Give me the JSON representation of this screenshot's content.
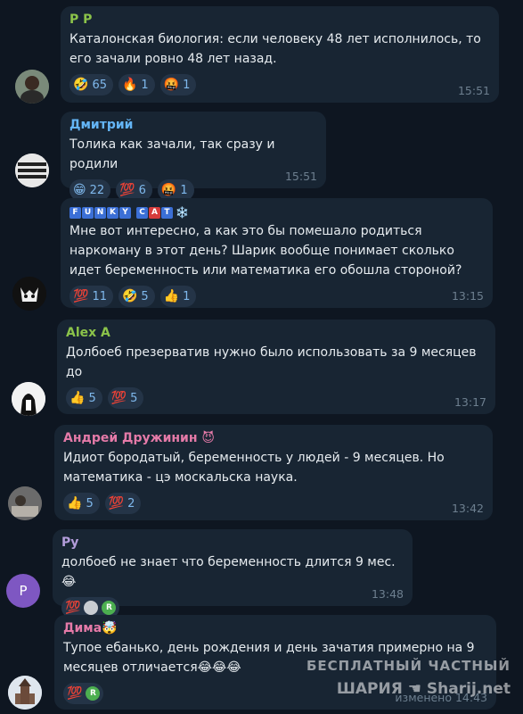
{
  "messages": [
    {
      "sender": "P P",
      "sender_color": "#8bc34a",
      "text": "Каталонская биология: если человеку 48 лет исполнилось, то его зачали ровно 48 лет назад.",
      "reactions": [
        {
          "emoji": "🤣",
          "count": "65"
        },
        {
          "emoji": "🔥",
          "count": "1"
        },
        {
          "emoji": "🤬",
          "count": "1"
        }
      ],
      "time": "15:51"
    },
    {
      "sender": "Дмитрий",
      "sender_color": "#64b5f6",
      "text": "Толика как зачали,  так сразу и родили",
      "reactions": [
        {
          "emoji": "😁",
          "count": "22"
        },
        {
          "emoji": "💯",
          "count": "6"
        },
        {
          "emoji": "🤬",
          "count": "1"
        }
      ],
      "time": "15:51"
    },
    {
      "sender_funky": "FUNKY CAT",
      "sender_suffix": "❄️",
      "text": "Мне вот интересно, а как это бы помешало родиться наркоману в этот день? Шарик вообще понимает сколько идет беременность или математика его обошла стороной?",
      "reactions": [
        {
          "emoji": "💯",
          "count": "11"
        },
        {
          "emoji": "🤣",
          "count": "5"
        },
        {
          "emoji": "👍",
          "count": "1"
        }
      ],
      "time": "13:15"
    },
    {
      "sender": "Alex A",
      "sender_color": "#8bc34a",
      "text": "Долбоеб презерватив нужно было использовать за 9 месяцев до",
      "reactions": [
        {
          "emoji": "👍",
          "count": "5"
        },
        {
          "emoji": "💯",
          "count": "5"
        }
      ],
      "time": "13:17"
    },
    {
      "sender": "Андрей Дружинин 😈",
      "sender_color": "#e57aa8",
      "text": "Идиот бородатый, беременность у людей - 9 месяцев. Но математика - цэ москальска наука.",
      "reactions": [
        {
          "emoji": "👍",
          "count": "5"
        },
        {
          "emoji": "💯",
          "count": "2"
        }
      ],
      "time": "13:42"
    },
    {
      "sender": "Ру",
      "sender_color": "#b39ddb",
      "avatar_letter": "Р",
      "text": "долбоеб не знает что беременность длится 9 мес.😂",
      "reactions": [
        {
          "emoji": "💯",
          "count": ""
        }
      ],
      "badge": "R",
      "time": "13:48"
    },
    {
      "sender": "Дима🤯",
      "sender_color": "#e57aa8",
      "text": "Тупое ебанько, день рождения и день зачатия примерно на 9 месяцев отличается😂😂😂",
      "reactions": [
        {
          "emoji": "💯",
          "count": ""
        }
      ],
      "badge": "R",
      "time": "изменено 14:43"
    }
  ],
  "watermark": {
    "line1": "БЕСПЛАТНЫЙ ЧАСТНЫЙ",
    "line2": "ШАРИЯ",
    "line3": "Sharij.net"
  },
  "colors": {
    "background": "#0e1621",
    "bubble": "#182533",
    "reaction_bg": "#243447",
    "reaction_text": "#7fb8ec",
    "time": "#6d7f8f"
  }
}
